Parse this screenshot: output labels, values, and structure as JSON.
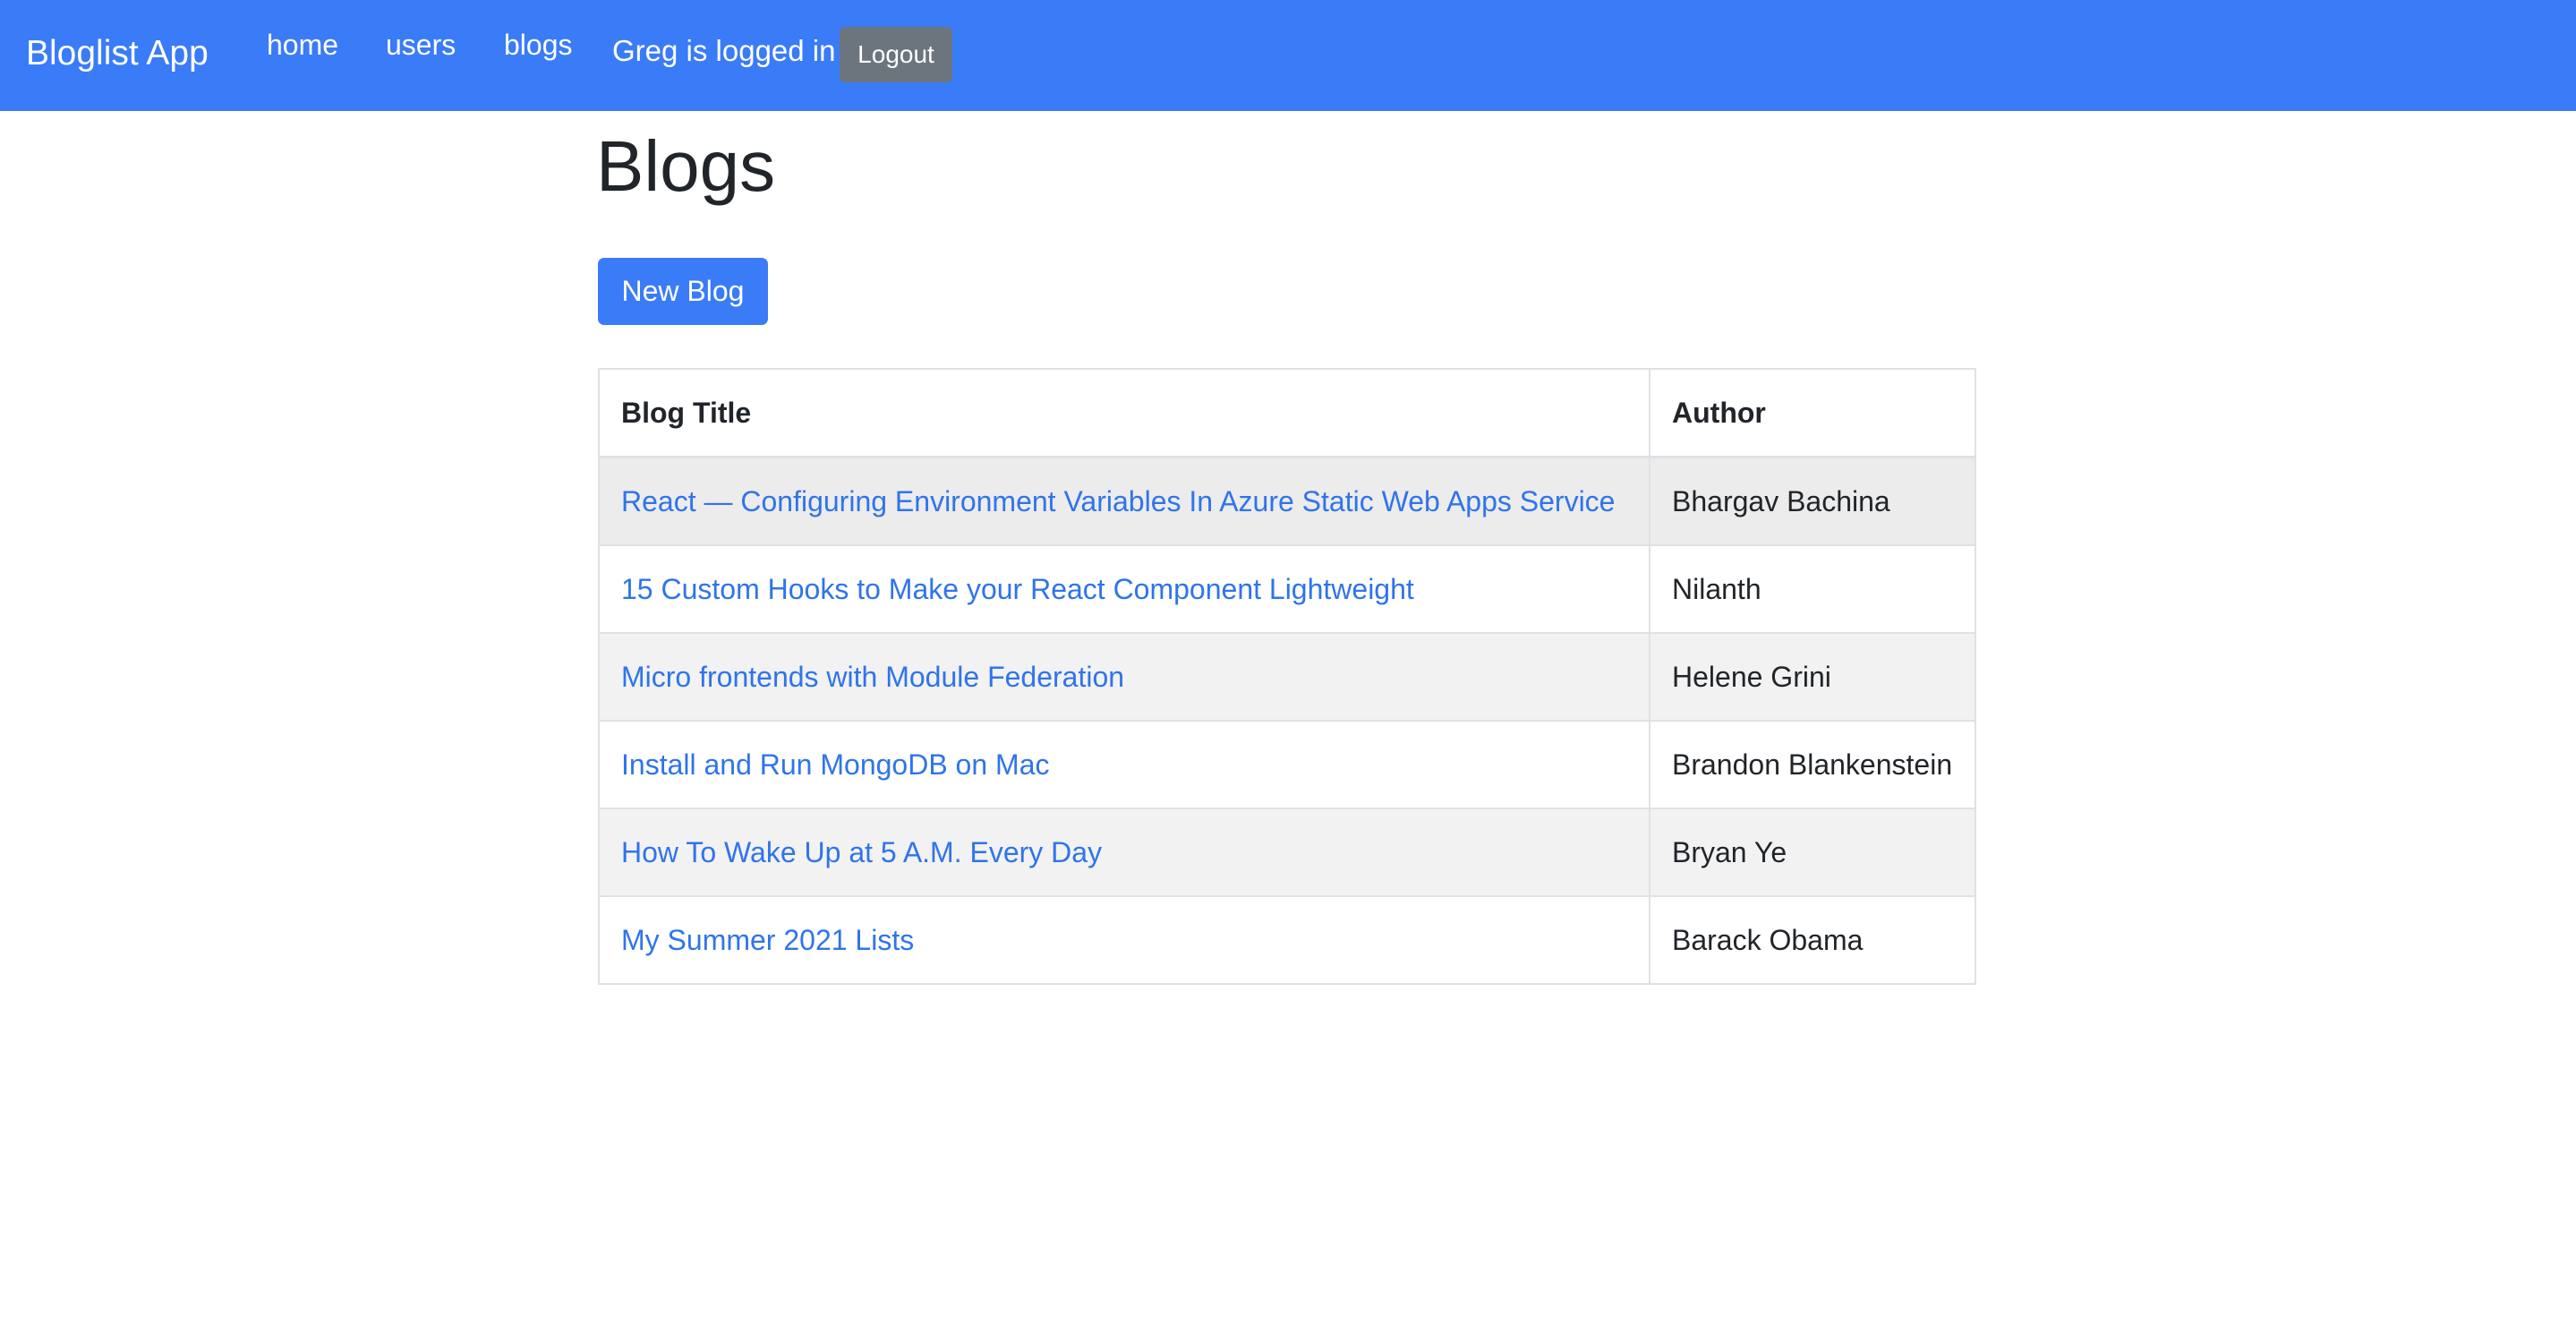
{
  "navbar": {
    "brand": "Bloglist App",
    "links": [
      {
        "label": "home"
      },
      {
        "label": "users"
      },
      {
        "label": "blogs"
      }
    ],
    "login_status": "Greg is logged in",
    "logout_label": "Logout",
    "colors": {
      "background": "#3a7bf7",
      "logout_button": "#6c757d"
    }
  },
  "main": {
    "title": "Blogs",
    "new_blog_label": "New Blog",
    "table": {
      "columns": [
        "Blog Title",
        "Author"
      ],
      "rows": [
        {
          "title": "React — Configuring Environment Variables In Azure Static Web Apps Service",
          "author": "Bhargav Bachina"
        },
        {
          "title": "15 Custom Hooks to Make your React Component Lightweight",
          "author": "Nilanth"
        },
        {
          "title": "Micro frontends with Module Federation",
          "author": "Helene Grini"
        },
        {
          "title": "Install and Run MongoDB on Mac",
          "author": "Brandon Blankenstein"
        },
        {
          "title": "How To Wake Up at 5 A.M. Every Day",
          "author": "Bryan Ye"
        },
        {
          "title": "My Summer 2021 Lists",
          "author": "Barack Obama"
        }
      ]
    },
    "colors": {
      "link": "#2f74ea",
      "primary_button": "#3a7bf7",
      "stripe": "#f2f2f2",
      "hover_row": "#ececec",
      "border": "#dee2e6"
    }
  }
}
